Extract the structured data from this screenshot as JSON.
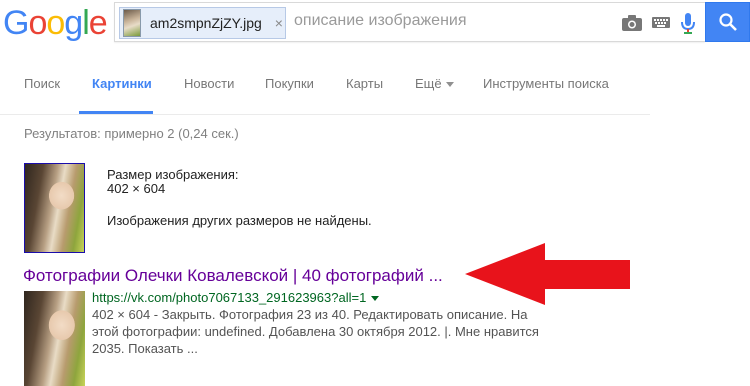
{
  "logo": {
    "letters": [
      "G",
      "o",
      "o",
      "g",
      "l",
      "e"
    ]
  },
  "search": {
    "image_chip_name": "am2smpnZjZY.jpg",
    "image_chip_close": "×",
    "placeholder": "описание изображения"
  },
  "tabs": [
    {
      "label": "Поиск",
      "active": false
    },
    {
      "label": "Картинки",
      "active": true
    },
    {
      "label": "Новости",
      "active": false
    },
    {
      "label": "Покупки",
      "active": false
    },
    {
      "label": "Карты",
      "active": false
    },
    {
      "label": "Ещё",
      "active": false
    },
    {
      "label": "Инструменты поиска",
      "active": false
    }
  ],
  "result_stats": "Результатов: примерно 2 (0,24 сек.)",
  "image_info": {
    "size_label": "Размер изображения:",
    "size_value": "402 × 604",
    "no_other_sizes": "Изображения других размеров не найдены."
  },
  "result": {
    "title": "Фотографии Олечки Ковалевской | 40 фотографий ...",
    "url": "https://vk.com/photo7067133_291623963?all=1",
    "snippet": "402 × 604 - Закрыть. Фотография 23 из 40. Редактировать описание. На этой фотографии: undefined. Добавлена 30 октября 2012. |. Мне нравится 2035. Показать ..."
  },
  "colors": {
    "accent": "#4285f4",
    "visited_link": "#660099",
    "url_green": "#006621",
    "arrow_red": "#e8131b"
  },
  "icons": [
    "camera-icon",
    "keyboard-icon",
    "microphone-icon",
    "search-icon",
    "close-icon",
    "chevron-down-icon",
    "red-arrow"
  ]
}
